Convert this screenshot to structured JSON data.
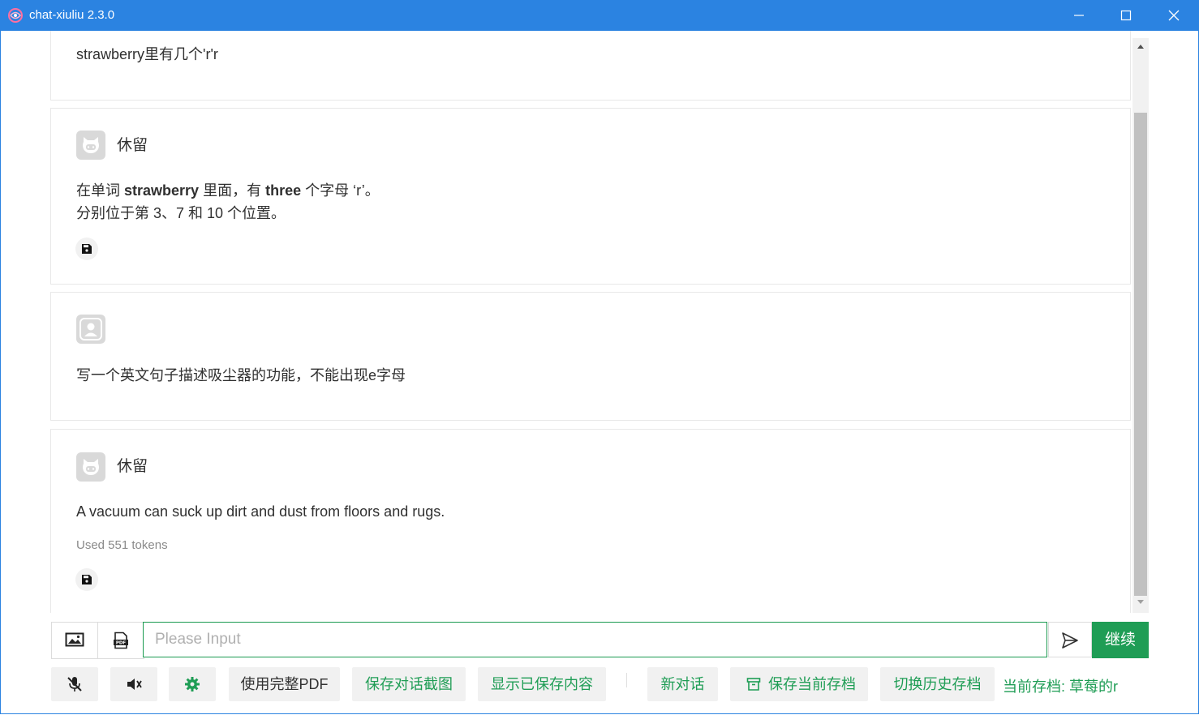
{
  "window": {
    "title": "chat-xiuliu 2.3.0"
  },
  "messages": [
    {
      "role": "user",
      "text": "strawberry里有几个'r'r"
    },
    {
      "role": "assistant",
      "name": "休留",
      "line1": {
        "pre": "在单词 ",
        "bold1": "strawberry",
        "mid": " 里面，有 ",
        "bold2": "three",
        "post": " 个字母 ‘r’。"
      },
      "line2": "分别位于第 3、7 和 10 个位置。"
    },
    {
      "role": "user",
      "text": "写一个英文句子描述吸尘器的功能，不能出现e字母"
    },
    {
      "role": "assistant",
      "name": "休留",
      "text": "A vacuum can suck up dirt and dust from floors and rugs.",
      "tokens": "Used 551 tokens"
    }
  ],
  "input": {
    "placeholder": "Please Input",
    "value": ""
  },
  "buttons": {
    "continue": "继续",
    "full_pdf": "使用完整PDF",
    "save_screenshot": "保存对话截图",
    "show_saved": "显示已保存内容",
    "new_chat": "新对话",
    "save_archive": "保存当前存档",
    "switch_archive": "切换历史存档"
  },
  "status": {
    "current_archive": "当前存档: 草莓的r"
  },
  "colors": {
    "titlebar": "#2b83e1",
    "accent_green": "#1f9d55"
  },
  "icons": [
    "app-logo-icon",
    "minimize-icon",
    "maximize-icon",
    "close-icon",
    "bot-avatar-icon",
    "user-avatar-icon",
    "save-icon",
    "image-icon",
    "pdf-icon",
    "send-icon",
    "mic-off-icon",
    "speaker-off-icon",
    "gear-icon",
    "archive-icon"
  ]
}
